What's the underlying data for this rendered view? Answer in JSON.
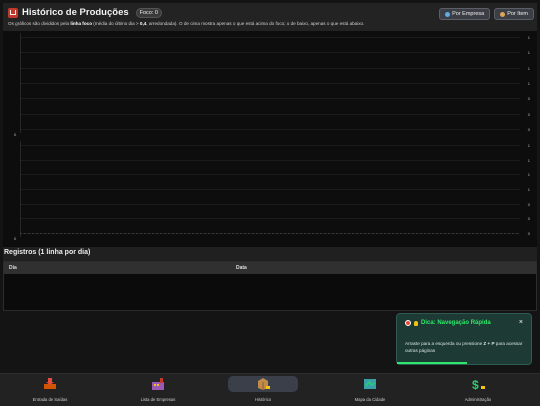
{
  "header": {
    "title": "Histórico de Produções",
    "badge": "Foco: 0",
    "subtitle_prefix": "Os gráficos são divididos pela ",
    "subtitle_bold1": "linha foco",
    "subtitle_mid": " (média do último dia > ",
    "subtitle_bold2": "0,4",
    "subtitle_suffix": ", arredondada). O de cima mostra apenas o que está acima do foco; o de baixo, apenas o que está abaixo.",
    "btn_empresa": "Por Empresa",
    "btn_item": "Por Item"
  },
  "charts": {
    "top_y_ticks": [
      "1",
      "1",
      "1",
      "1",
      "0",
      "0",
      "0"
    ],
    "top_zero": "0",
    "bottom_y_ticks": [
      "1",
      "1",
      "1",
      "1",
      "0",
      "0",
      "0"
    ],
    "bottom_zero": "0"
  },
  "records": {
    "title": "Registros (1 linha por dia)",
    "col_dia": "Dia",
    "col_data": "Data"
  },
  "toast": {
    "title": "Dica: Navegação Rápida",
    "close": "×",
    "body_prefix": "Arraste para a esquerda ou pressione ",
    "shortcut": "Z + P",
    "body_suffix": " para acessar outras páginas",
    "progress": 0.52
  },
  "nav": {
    "items": [
      {
        "label": "Entrada de Saídas",
        "icon": "inbox-tray-icon"
      },
      {
        "label": "Lista de Empresas",
        "icon": "factory-icon"
      },
      {
        "label": "Histórico",
        "icon": "package-icon"
      },
      {
        "label": "Mapa da Cidade",
        "icon": "map-icon"
      },
      {
        "label": "Administração",
        "icon": "dollar-icon"
      }
    ],
    "active_index": 2
  }
}
